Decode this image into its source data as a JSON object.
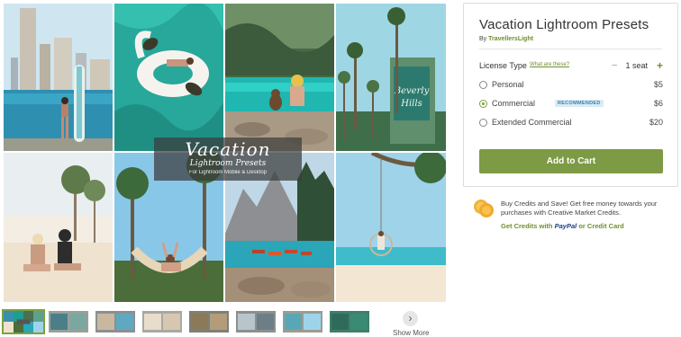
{
  "gallery": {
    "overlay": {
      "title": "Vacation",
      "subtitle": "Lightroom Presets",
      "caption": "For Lightroom Mobile & Desktop"
    },
    "tiles": [
      {
        "icon": "city-beach-paddleboard-photo"
      },
      {
        "icon": "flamingo-float-pool-photo"
      },
      {
        "icon": "lagoon-dog-woman-photo"
      },
      {
        "icon": "palm-hotel-sign-photo"
      },
      {
        "icon": "beach-friends-palms-photo"
      },
      {
        "icon": "hammock-tropics-photo"
      },
      {
        "icon": "mountain-lake-canoes-photo"
      },
      {
        "icon": "beach-swing-palm-photo"
      }
    ],
    "show_more": "Show More",
    "next_icon": "chevron-right-icon"
  },
  "product": {
    "title": "Vacation Lightroom Presets",
    "by_prefix": "By",
    "author": "TravellersLight",
    "license_label": "License Type",
    "license_link": "What are these?",
    "quantity": "1 seat",
    "options": [
      {
        "name": "Personal",
        "price": "$5",
        "checked": false
      },
      {
        "name": "Commercial",
        "price": "$6",
        "checked": true,
        "badge": "RECOMMENDED"
      },
      {
        "name": "Extended Commercial",
        "price": "$20",
        "checked": false
      }
    ],
    "add_to_cart": "Add to Cart"
  },
  "promo": {
    "text": "Buy Credits and Save! Get free money towards your purchases with Creative Market Credits.",
    "link_prefix": "Get Credits with",
    "paypal": "PayPal",
    "link_suffix": "or Credit Card"
  },
  "colors": {
    "accent_green": "#7d9a45",
    "link_green": "#6f8f2f",
    "badge_bg": "#d8ecf7",
    "badge_text": "#3b7fa8"
  }
}
